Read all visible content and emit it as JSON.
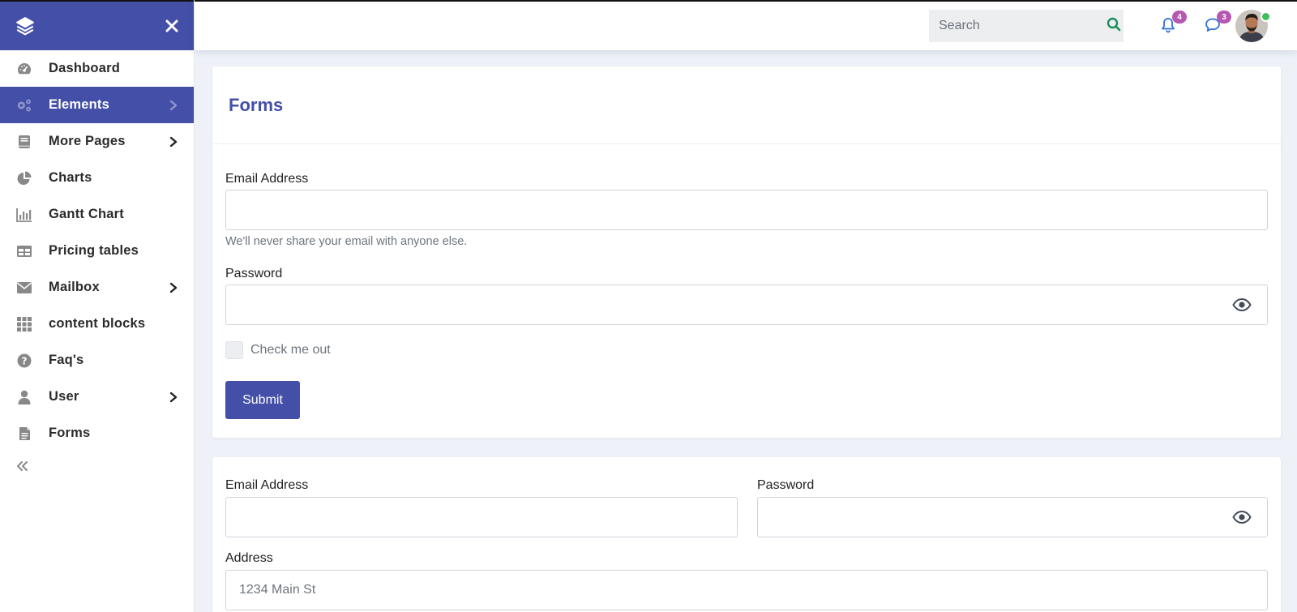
{
  "sidebar": {
    "items": [
      {
        "label": "Dashboard",
        "icon": "gauge-icon",
        "has_submenu": false
      },
      {
        "label": "Elements",
        "icon": "gears-icon",
        "has_submenu": true,
        "active": true
      },
      {
        "label": "More Pages",
        "icon": "book-icon",
        "has_submenu": true
      },
      {
        "label": "Charts",
        "icon": "pie-chart-icon",
        "has_submenu": false
      },
      {
        "label": "Gantt Chart",
        "icon": "bar-chart-icon",
        "has_submenu": false
      },
      {
        "label": "Pricing tables",
        "icon": "table-icon",
        "has_submenu": false
      },
      {
        "label": "Mailbox",
        "icon": "envelope-icon",
        "has_submenu": true
      },
      {
        "label": "content blocks",
        "icon": "grid-icon",
        "has_submenu": false
      },
      {
        "label": "Faq's",
        "icon": "question-circle-icon",
        "has_submenu": false
      },
      {
        "label": "User",
        "icon": "user-icon",
        "has_submenu": true
      },
      {
        "label": "Forms",
        "icon": "file-text-icon",
        "has_submenu": false
      }
    ]
  },
  "topbar": {
    "search_placeholder": "Search",
    "notifications_count": "4",
    "messages_count": "3"
  },
  "form1": {
    "title": "Forms",
    "email_label": "Email Address",
    "email_value": "",
    "email_help": "We'll never share your email with anyone else.",
    "password_label": "Password",
    "password_value": "",
    "checkbox_label": "Check me out",
    "submit_label": "Submit"
  },
  "form2": {
    "email_label": "Email Address",
    "email_value": "",
    "password_label": "Password",
    "password_value": "",
    "address_label": "Address",
    "address_placeholder": "1234 Main St"
  },
  "colors": {
    "primary": "#4450a8",
    "badge": "#b558b0",
    "online": "#3fbf5a",
    "search_icon": "#1a8f5c",
    "top_icon": "#2f6fd6"
  }
}
